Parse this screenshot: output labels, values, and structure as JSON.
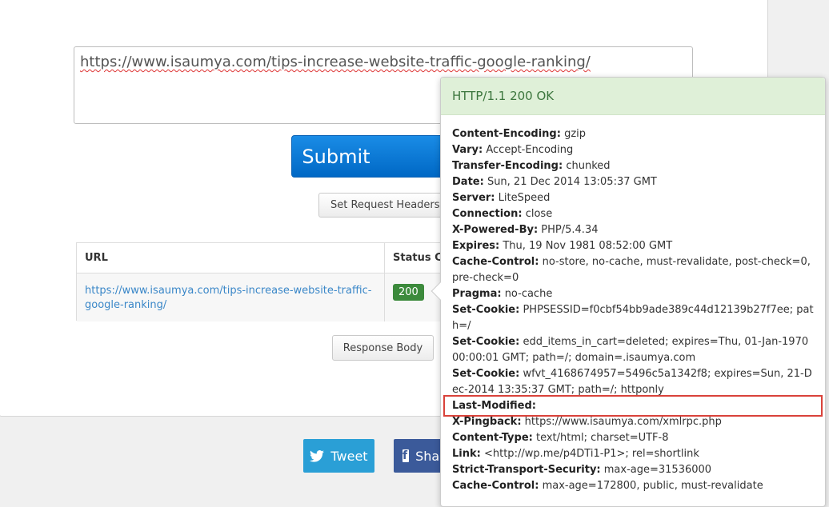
{
  "form": {
    "url_value": "https://www.isaumya.com/tips-increase-website-traffic-google-ranking/",
    "submit_label": "Submit",
    "set_headers_label": "Set Request Headers"
  },
  "results_table": {
    "col_url": "URL",
    "col_status": "Status Code",
    "row_url": "https://www.isaumya.com/tips-increase-website-traffic-google-ranking/",
    "row_status": "200"
  },
  "response_body_label": "Response Body",
  "social": {
    "tweet_label": "Tweet",
    "share_label": "Share"
  },
  "popover": {
    "status_line": "HTTP/1.1 200 OK",
    "headers": [
      {
        "k": "Content-Encoding:",
        "v": "gzip"
      },
      {
        "k": "Vary:",
        "v": "Accept-Encoding"
      },
      {
        "k": "Transfer-Encoding:",
        "v": "chunked"
      },
      {
        "k": "Date:",
        "v": "Sun, 21 Dec 2014 13:05:37 GMT"
      },
      {
        "k": "Server:",
        "v": "LiteSpeed"
      },
      {
        "k": "Connection:",
        "v": "close"
      },
      {
        "k": "X-Powered-By:",
        "v": "PHP/5.4.34"
      },
      {
        "k": "Expires:",
        "v": "Thu, 19 Nov 1981 08:52:00 GMT"
      },
      {
        "k": "Cache-Control:",
        "v": "no-store, no-cache, must-revalidate, post-check=0, pre-check=0"
      },
      {
        "k": "Pragma:",
        "v": "no-cache"
      },
      {
        "k": "Set-Cookie:",
        "v": "PHPSESSID=f0cbf54bb9ade389c44d12139b27f7ee; path=/"
      },
      {
        "k": "Set-Cookie:",
        "v": "edd_items_in_cart=deleted; expires=Thu, 01-Jan-1970 00:00:01 GMT; path=/; domain=.isaumya.com"
      },
      {
        "k": "Set-Cookie:",
        "v": "wfvt_4168674957=5496c5a1342f8; expires=Sun, 21-Dec-2014 13:35:37 GMT; path=/; httponly"
      },
      {
        "k": "Last-Modified:",
        "v": ""
      },
      {
        "k": "X-Pingback:",
        "v": "https://www.isaumya.com/xmlrpc.php"
      },
      {
        "k": "Content-Type:",
        "v": "text/html; charset=UTF-8"
      },
      {
        "k": "Link:",
        "v": "<http://wp.me/p4DTi1-P1>; rel=shortlink"
      },
      {
        "k": "Strict-Transport-Security:",
        "v": "max-age=31536000"
      },
      {
        "k": "Cache-Control:",
        "v": "max-age=172800, public, must-revalidate"
      }
    ]
  },
  "colors": {
    "submit": "#0a78d6",
    "status_badge": "#3c8a3c",
    "popover_title_bg": "#dff0d8",
    "highlight_border": "#d9423a",
    "tweet": "#2a9fd6",
    "share": "#3b5a9a"
  }
}
